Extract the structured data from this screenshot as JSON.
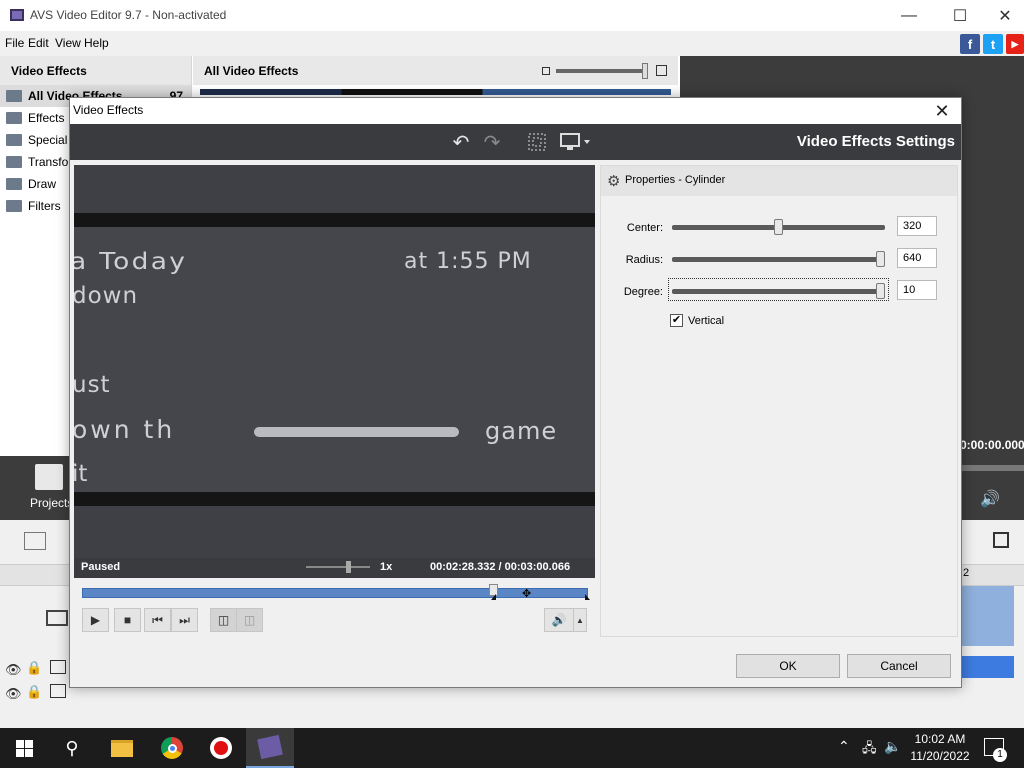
{
  "window": {
    "title": "AVS Video Editor 9.7 - Non-activated",
    "minimize_icon": "minimize-icon",
    "maximize_icon": "maximize-icon",
    "close_icon": "close-icon"
  },
  "menu": [
    "File",
    "Edit",
    "View",
    "Help"
  ],
  "social": [
    "f",
    "t",
    "▶"
  ],
  "left_panel": {
    "header": "Video Effects",
    "items": [
      "All Video Effects",
      "Effects",
      "Special",
      "Transform",
      "Draw",
      "Filters"
    ],
    "count": "97"
  },
  "mid_panel": {
    "header": "All Video Effects"
  },
  "projects_label": "Projects",
  "right_timecode": "0:00:00.000",
  "timeline_mark": "2",
  "dialog": {
    "title": "Video Effects",
    "heading": "Video Effects Settings",
    "status": "Paused",
    "speed": "1x",
    "time_current": "00:02:28.332",
    "time_separator": " / ",
    "time_total": "00:03:00.066",
    "seek_position": 0.82,
    "video_lines": [
      "a Today",
      "at 1:55 PM",
      "down",
      "ust",
      "own th",
      "game",
      "it"
    ],
    "properties_title": "Properties - Cylinder",
    "properties": [
      {
        "label": "Center:",
        "value": "320",
        "level": 0.5
      },
      {
        "label": "Radius:",
        "value": "640",
        "level": 1.0
      },
      {
        "label": "Degree:",
        "value": "10",
        "level": 1.0
      }
    ],
    "vertical_label": "Vertical",
    "vertical_checked": true,
    "ok_label": "OK",
    "cancel_label": "Cancel"
  },
  "taskbar": {
    "time": "10:02 AM",
    "date": "11/20/2022",
    "notif_count": "1"
  },
  "colors": {
    "toolbar_dark": "#3a3b3f",
    "seek_blue": "#5b86c6",
    "taskbar": "#1c1c1c"
  }
}
